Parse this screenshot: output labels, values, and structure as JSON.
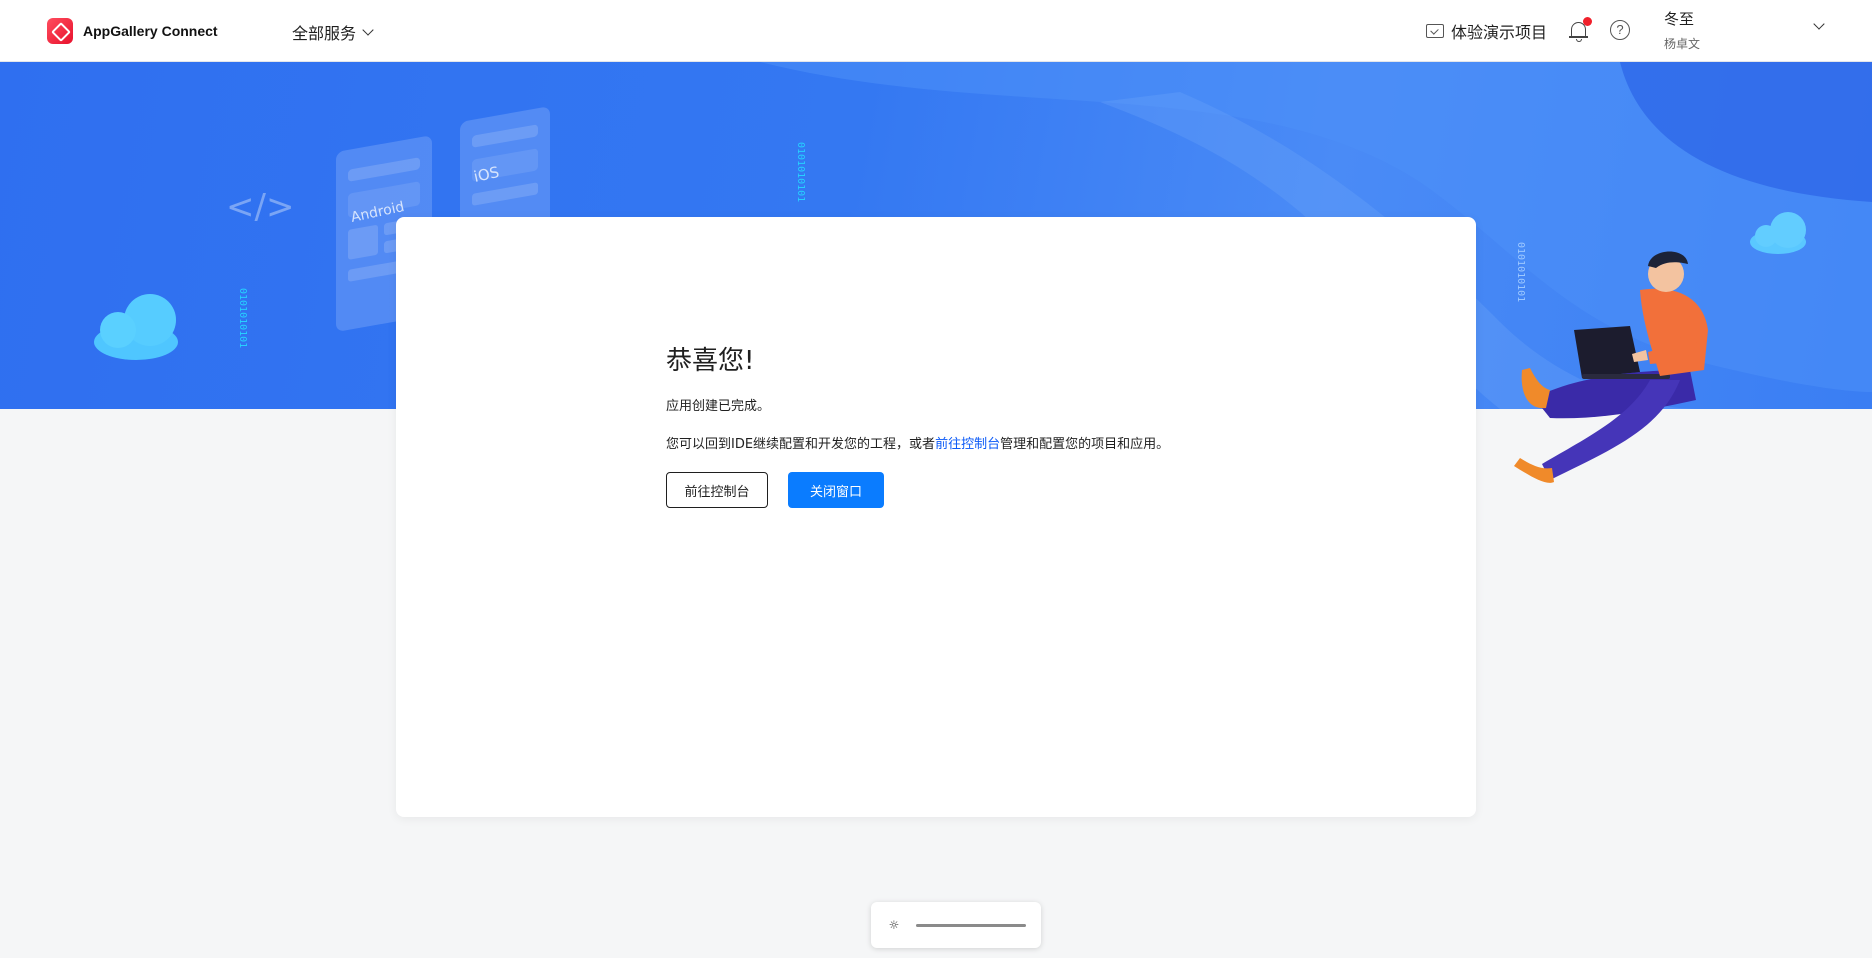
{
  "header": {
    "app_name": "AppGallery Connect",
    "services_label": "全部服务",
    "demo_label": "体验演示项目",
    "user_name": "冬至",
    "user_sub": "杨卓文"
  },
  "banner": {
    "tag_android": "Android",
    "tag_ios": "iOS",
    "code_symbol": "</>",
    "binary_text": "0101010101"
  },
  "card": {
    "title": "恭喜您!",
    "line1": "应用创建已完成。",
    "line2_prefix": "您可以回到IDE继续配置和开发您的工程，或者",
    "line2_link": "前往控制台",
    "line2_suffix": "管理和配置您的项目和应用。",
    "btn_console": "前往控制台",
    "btn_close": "关闭窗口"
  },
  "widget": {
    "icon": "brightness-icon"
  },
  "colors": {
    "primary": "#0a7cff",
    "link": "#0a59f7",
    "banner": "#3478f2",
    "notify_dot": "#f0202b"
  }
}
